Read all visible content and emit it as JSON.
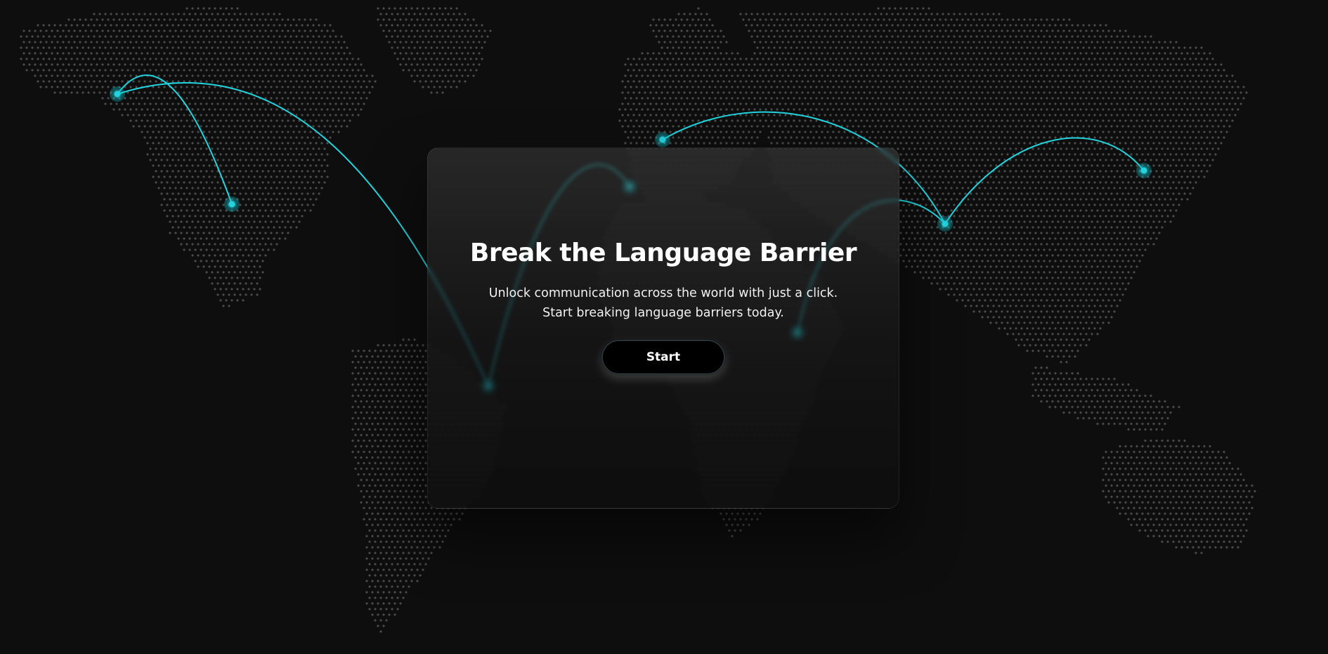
{
  "hero": {
    "title": "Break the Language Barrier",
    "subtitle": "Unlock communication across the world with just a click. Start breaking language barriers today.",
    "button_label": "Start"
  },
  "theme": {
    "background": "#0e0e0e",
    "dot_color": "#4a4a4a",
    "accent": "#22d3dd",
    "glow": "#0fb5c0"
  },
  "map": {
    "style": "dotted world map",
    "routes": [
      {
        "from": "north-america-west",
        "to": "north-america-central"
      },
      {
        "from": "north-america-west",
        "to": "south-america-north"
      },
      {
        "from": "south-america-north",
        "to": "western-europe"
      },
      {
        "from": "northern-europe",
        "to": "central-asia"
      },
      {
        "from": "east-africa",
        "to": "central-asia"
      },
      {
        "from": "central-asia",
        "to": "east-asia"
      }
    ]
  }
}
